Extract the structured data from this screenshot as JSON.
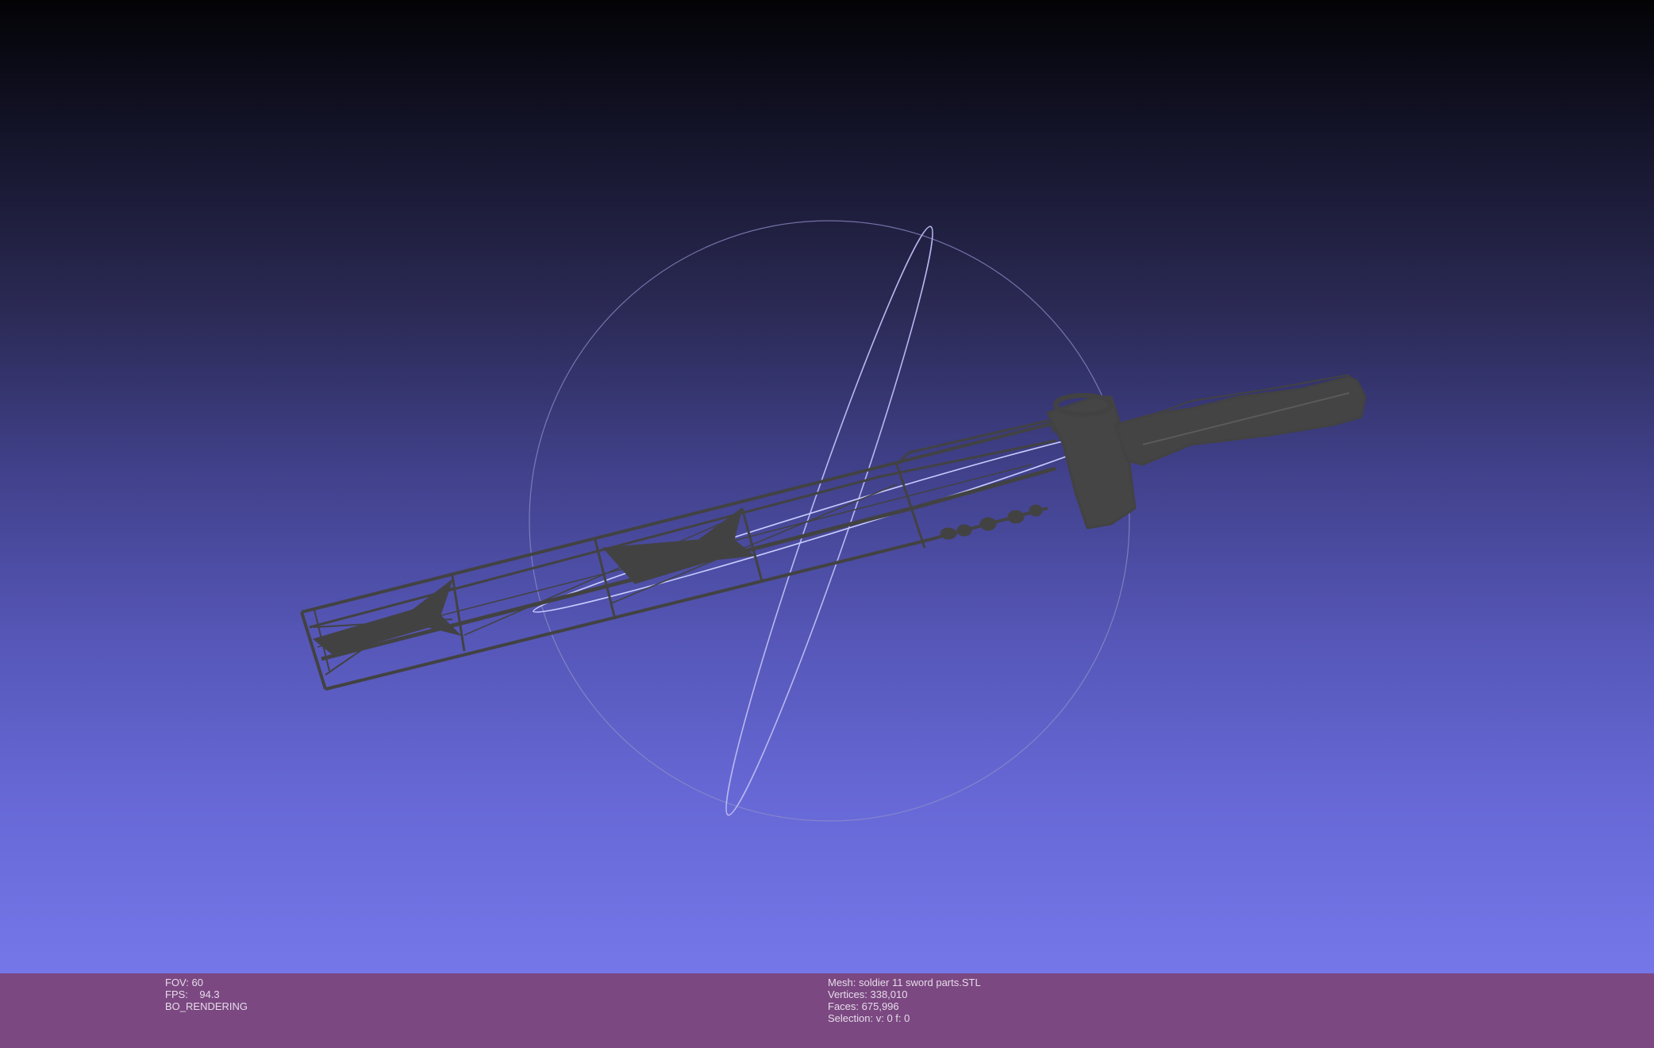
{
  "viewer": {
    "colors": {
      "background_top": "#030306",
      "background_bottom": "#7577e9",
      "status_bar": "#7b4882",
      "status_text": "#e6dce8",
      "mesh_wireframe": "#424242",
      "trackball": "#9a9ad8"
    },
    "mesh_render_mode": "wireframe",
    "trackball_visible": true
  },
  "status_left": {
    "fov_label": "FOV:",
    "fov_value": "60",
    "fps_label": "FPS:",
    "fps_value": "94.3",
    "render_mode": "BO_RENDERING"
  },
  "status_right": {
    "mesh_label": "Mesh:",
    "mesh_value": "soldier 11 sword parts.STL",
    "vertices_label": "Vertices:",
    "vertices_value": "338,010",
    "faces_label": "Faces:",
    "faces_value": "675,996",
    "selection_label": "Selection:",
    "selection_value": "v: 0 f: 0"
  }
}
